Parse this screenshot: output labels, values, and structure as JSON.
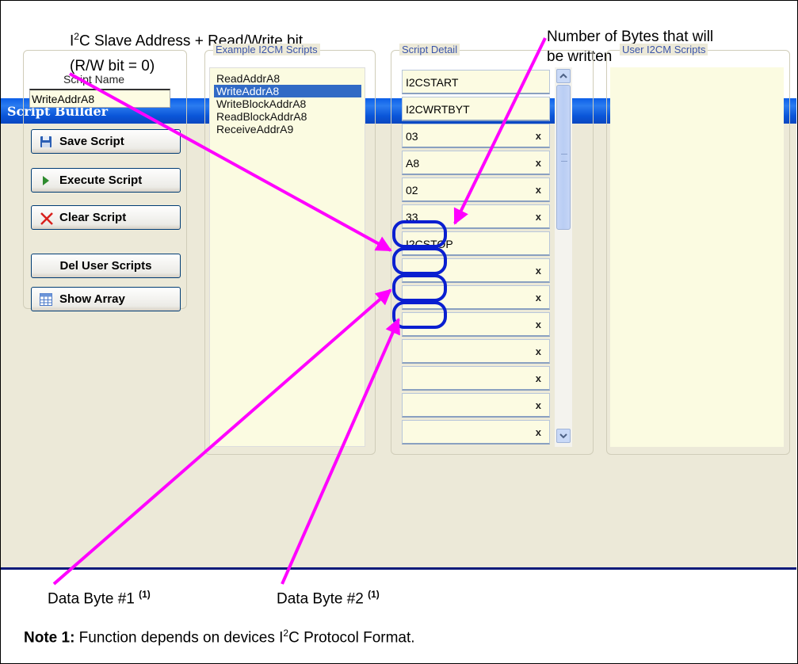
{
  "annotations": {
    "slave_address_prefix": "I",
    "slave_address_sup": "2",
    "slave_address_suffix": "C Slave Address + Read/Write bit",
    "rw_bit": "(R/W bit = 0)",
    "num_bytes_line1": "Number of Bytes that will",
    "num_bytes_line2": "be written",
    "data_byte_1": "Data Byte #1",
    "data_byte_2": "Data Byte #2",
    "footnote_marker": "(1)",
    "note_label": "Note 1:",
    "note_text_a": " Function depends on devices I",
    "note_sup": "2",
    "note_text_b": "C Protocol Format."
  },
  "window": {
    "title": "Script Builder"
  },
  "script_name": {
    "label": "Script Name",
    "value": "WriteAddrA8"
  },
  "buttons": {
    "save": "Save Script",
    "execute": "Execute Script",
    "clear": "Clear Script",
    "del_user": "Del User Scripts",
    "show_array": "Show Array"
  },
  "groups": {
    "examples": "Example I2CM Scripts",
    "detail": "Script Detail",
    "user": "User I2CM Scripts"
  },
  "examples": [
    "ReadAddrA8",
    "WriteAddrA8",
    "WriteBlockAddrA8",
    "ReadBlockAddrA8",
    "ReceiveAddrA9"
  ],
  "selected_example": "WriteAddrA8",
  "script_rows": [
    {
      "value": "I2CSTART",
      "del": ""
    },
    {
      "value": "I2CWRTBYT",
      "del": ""
    },
    {
      "value": "03",
      "del": "x"
    },
    {
      "value": "A8",
      "del": "x"
    },
    {
      "value": "02",
      "del": "x"
    },
    {
      "value": "33",
      "del": "x"
    },
    {
      "value": "I2CSTOP",
      "del": ""
    },
    {
      "value": "",
      "del": "x"
    },
    {
      "value": "",
      "del": "x"
    },
    {
      "value": "",
      "del": "x"
    },
    {
      "value": "",
      "del": "x"
    },
    {
      "value": "",
      "del": "x"
    },
    {
      "value": "",
      "del": "x"
    },
    {
      "value": "",
      "del": "x"
    }
  ],
  "colors": {
    "arrow": "#ff00ff",
    "highlight": "#0a1fd0",
    "titlebar": "#0a55d8",
    "list_bg": "#fbfbe1",
    "selection": "#316ac5"
  }
}
